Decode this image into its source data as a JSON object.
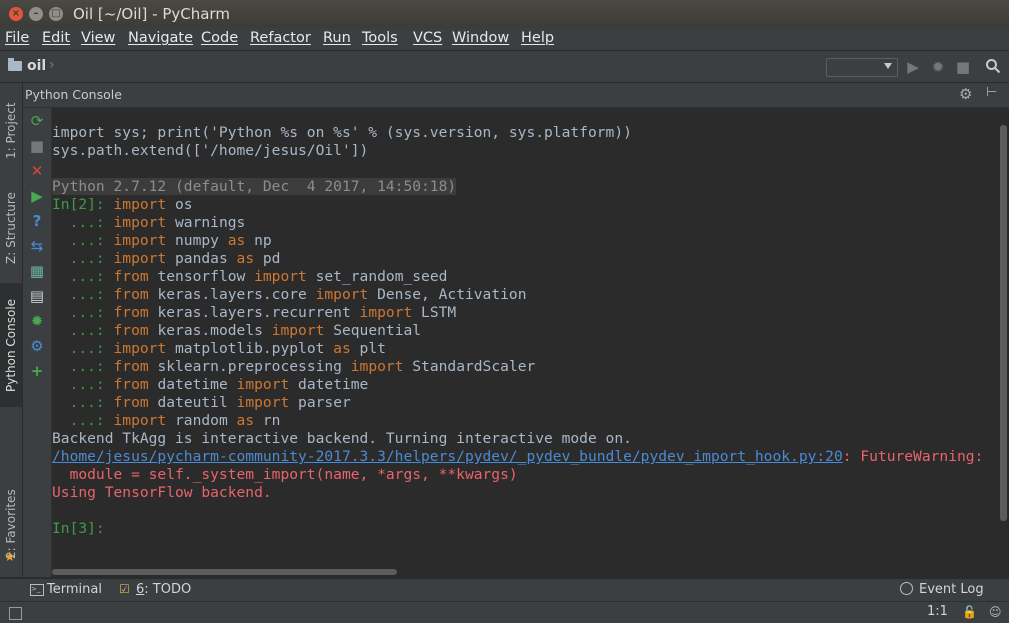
{
  "window": {
    "title": "Oil [~/Oil] - PyCharm",
    "close_glyph": "×",
    "min_glyph": "–",
    "max_glyph": "□"
  },
  "menu": [
    "File",
    "Edit",
    "View",
    "Navigate",
    "Code",
    "Refactor",
    "Run",
    "Tools",
    "VCS",
    "Window",
    "Help"
  ],
  "navbar": {
    "project": "oil",
    "run_config": ""
  },
  "side_tabs": {
    "project": "1: Project",
    "structure": "Z: Structure",
    "python_console": "Python Console",
    "favorites": "2: Favorites"
  },
  "tool_window": {
    "title": "Python Console"
  },
  "console": {
    "setup_line1": "import sys; print('Python %s on %s' % (sys.version, sys.platform))",
    "setup_line2": "sys.path.extend(['/home/jesus/Oil'])",
    "banner": "Python 2.7.12 (default, Dec  4 2017, 14:50:18)",
    "prompt_in2": "In[2]: ",
    "cont_prompt": "  ...: ",
    "code": {
      "l1_kw": "import",
      "l1_rest": " os",
      "l2_kw": "import",
      "l2_rest": " warnings",
      "l3_kw1": "import",
      "l3_mid": " numpy ",
      "l3_kw2": "as",
      "l3_rest": " np",
      "l4_kw1": "import",
      "l4_mid": " pandas ",
      "l4_kw2": "as",
      "l4_rest": " pd",
      "l5_kw1": "from",
      "l5_mid": " tensorflow ",
      "l5_kw2": "import",
      "l5_rest": " set_random_seed",
      "l6_kw1": "from",
      "l6_mid": " keras.layers.core ",
      "l6_kw2": "import",
      "l6_rest": " Dense, Activation",
      "l7_kw1": "from",
      "l7_mid": " keras.layers.recurrent ",
      "l7_kw2": "import",
      "l7_rest": " LSTM",
      "l8_kw1": "from",
      "l8_mid": " keras.models ",
      "l8_kw2": "import",
      "l8_rest": " Sequential",
      "l9_kw1": "import",
      "l9_mid": " matplotlib.pyplot ",
      "l9_kw2": "as",
      "l9_rest": " plt",
      "l10_kw1": "from",
      "l10_mid": " sklearn.preprocessing ",
      "l10_kw2": "import",
      "l10_rest": " StandardScaler",
      "l11_kw1": "from",
      "l11_mid": " datetime ",
      "l11_kw2": "import",
      "l11_rest": " datetime",
      "l12_kw1": "from",
      "l12_mid": " dateutil ",
      "l12_kw2": "import",
      "l12_rest": " parser",
      "l13_kw1": "import",
      "l13_mid": " random ",
      "l13_kw2": "as",
      "l13_rest": " rn"
    },
    "backend_msg": "Backend TkAgg is interactive backend. Turning interactive mode on.",
    "warning_link": "/home/jesus/pycharm-community-2017.3.3/helpers/pydev/_pydev_bundle/pydev_import_hook.py:20",
    "warning_suffix": ": FutureWarning: ",
    "warning_line2": "  module = self._system_import(name, *args, **kwargs)",
    "tf_backend": "Using TensorFlow backend.",
    "prompt_in3": "In[3]: "
  },
  "bottom_tabs": {
    "terminal": "Terminal",
    "todo_num": "6",
    "todo_label": ": TODO",
    "event_log": "Event Log"
  },
  "status": {
    "position": "1:1"
  },
  "colors": {
    "keyword": "#cc7832",
    "prompt": "#3d9b45",
    "error": "#e8646b",
    "link": "#4a8bd5",
    "text": "#a9b7c6"
  }
}
